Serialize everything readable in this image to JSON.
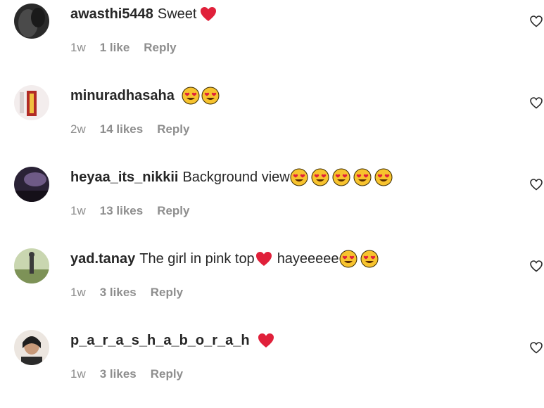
{
  "comments": [
    {
      "username": "awasthi5448",
      "text": "Sweet",
      "trailing_emojis": [
        "red-heart"
      ],
      "age": "1w",
      "likes": "1 like",
      "reply": "Reply",
      "avatar_colors": [
        "#3a3a3a",
        "#1b1b1b"
      ]
    },
    {
      "username": "minuradhasaha",
      "text": "",
      "trailing_emojis": [
        "heart-eyes",
        "heart-eyes"
      ],
      "age": "2w",
      "likes": "14 likes",
      "reply": "Reply",
      "avatar_colors": [
        "#f1e6e6",
        "#c0392b"
      ]
    },
    {
      "username": "heyaa_its_nikkii",
      "text": "Background view",
      "trailing_emojis": [
        "heart-eyes",
        "heart-eyes",
        "heart-eyes",
        "heart-eyes",
        "heart-eyes"
      ],
      "age": "1w",
      "likes": "13 likes",
      "reply": "Reply",
      "avatar_colors": [
        "#5b4a6e",
        "#1f1a2c"
      ]
    },
    {
      "username": "yad.tanay",
      "text": "The girl in pink top",
      "middle_emoji": "red-heart",
      "text_after": "hayeeeee",
      "trailing_emojis": [
        "heart-eyes",
        "heart-eyes"
      ],
      "age": "1w",
      "likes": "3 likes",
      "reply": "Reply",
      "avatar_colors": [
        "#b8c9a0",
        "#6b7f4a"
      ]
    },
    {
      "username": "p_a_r_a_s_h_a_b_o_r_a_h",
      "text": "",
      "trailing_emojis": [
        "red-heart"
      ],
      "age": "1w",
      "likes": "3 likes",
      "reply": "Reply",
      "avatar_colors": [
        "#e8e2dc",
        "#2b2b2b"
      ]
    }
  ],
  "colors": {
    "text": "#262626",
    "meta": "#8e8e8e",
    "heart_red": "#e0203a",
    "emoji_face": "#f7c32e"
  }
}
